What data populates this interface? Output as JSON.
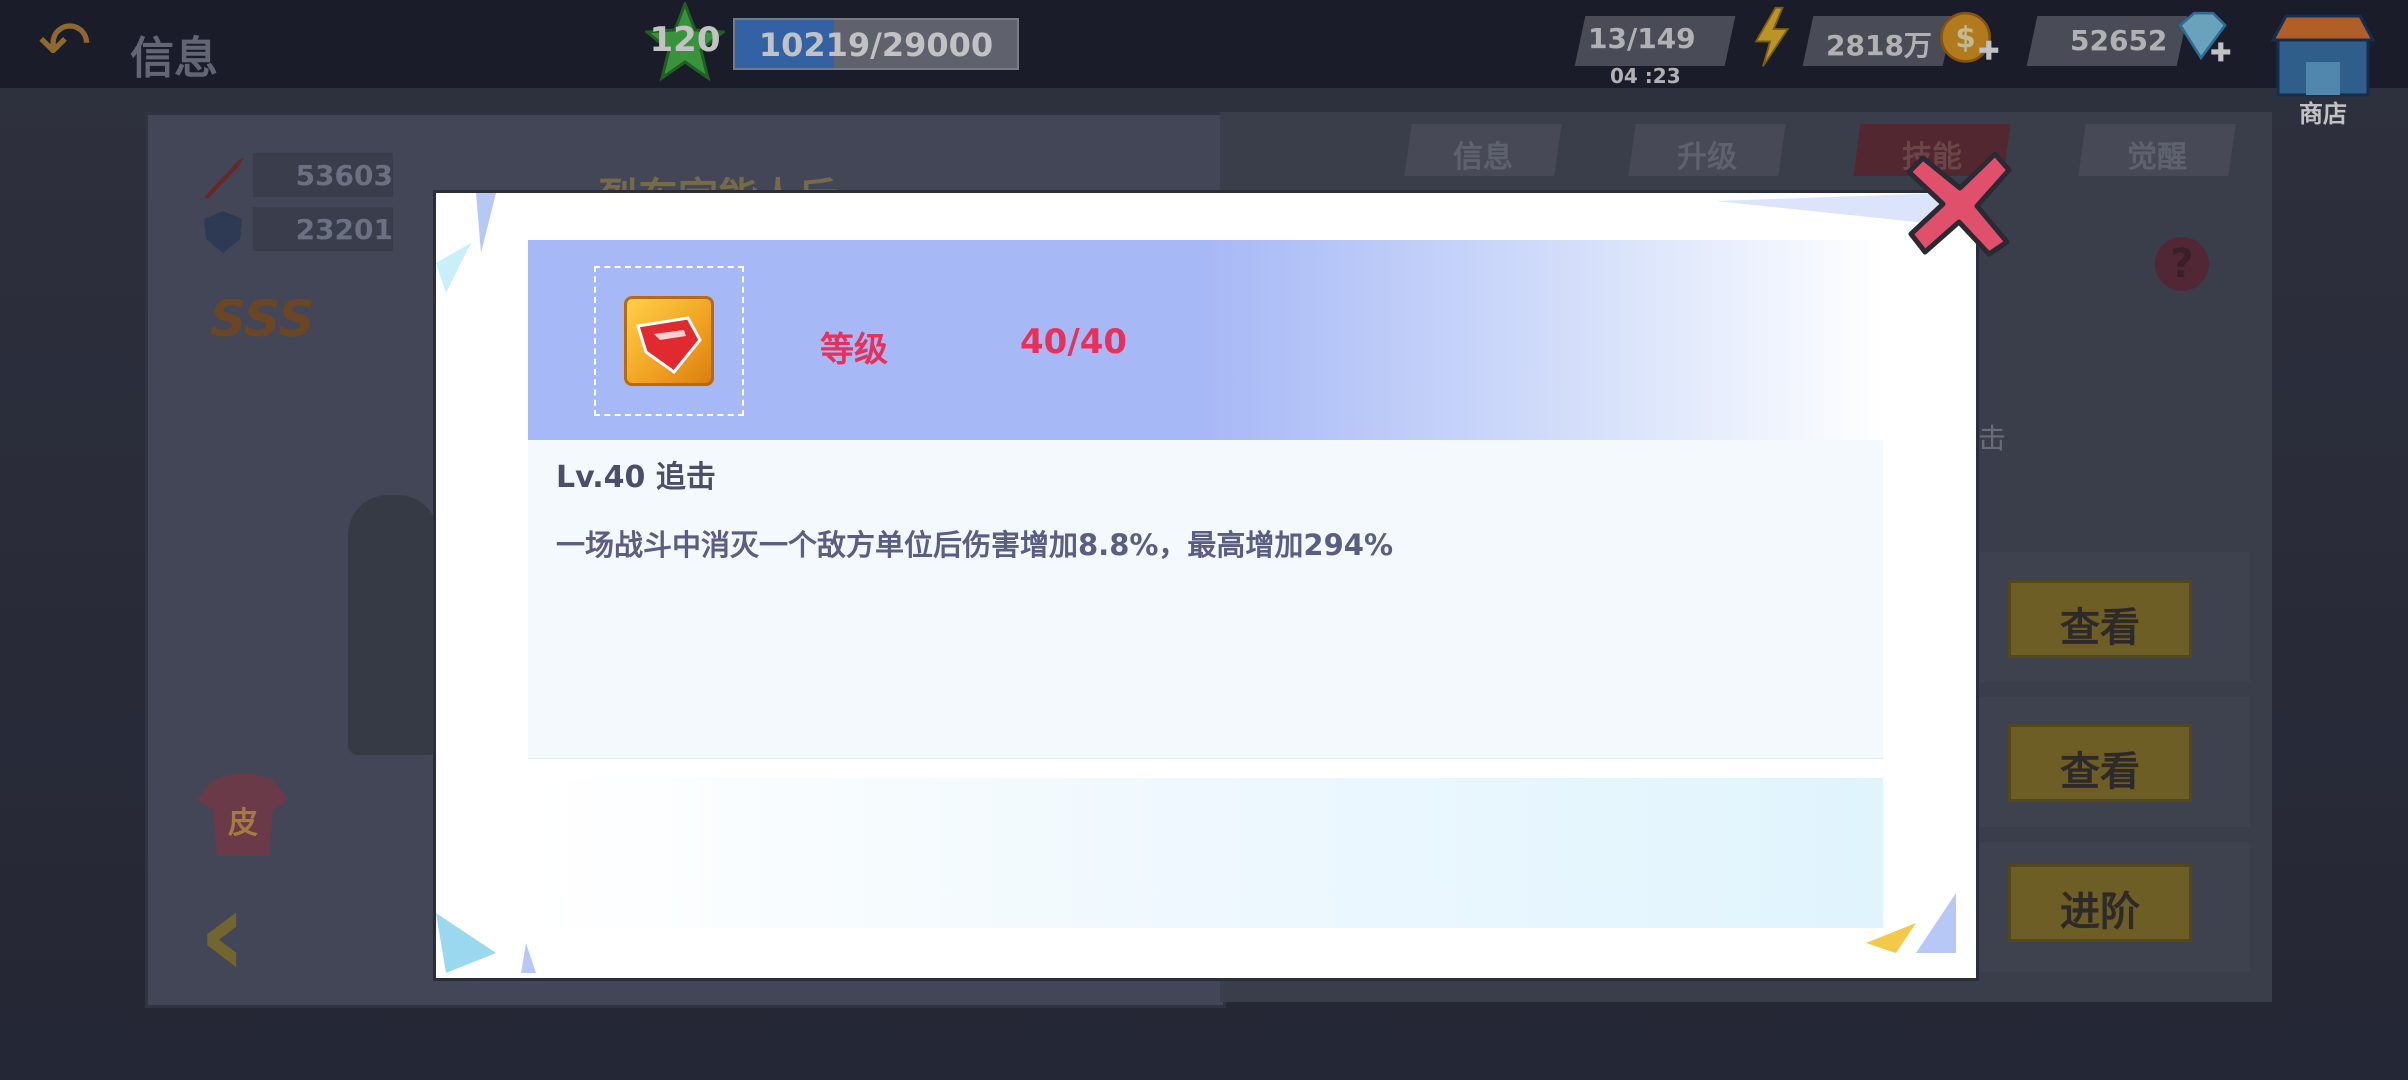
{
  "topbar": {
    "back_label": "信息",
    "level": "120",
    "exp_text": "10219/29000",
    "exp_fraction": 0.352,
    "energy": "13/149",
    "energy_timer": "04 :23",
    "gold": "2818万",
    "gems": "52652",
    "shop_label": "商店"
  },
  "left_panel": {
    "attack": "53603",
    "defense": "23201",
    "rank": "SSS",
    "hero_name": "烈东宗能人斥",
    "shirt_label": "皮"
  },
  "right_panel": {
    "tabs": [
      "信息",
      "升级",
      "技能",
      "觉醒"
    ],
    "partial_text": "击",
    "buttons": [
      "查看",
      "查看",
      "进阶"
    ]
  },
  "modal": {
    "level_label": "等级",
    "level_value": "40/40",
    "skill_title": "Lv.40 追击",
    "skill_desc": "一场战斗中消灭一个敌方单位后伤害增加8.8%，最高增加294%"
  },
  "colors": {
    "accent_pink": "#e8305a",
    "header_blue": "#a7b8f6",
    "text_navy": "#4a4e6a"
  },
  "icons": {
    "back": "back-arrow-icon",
    "level": "green-star-icon",
    "energy": "lightning-icon",
    "gold": "coin-plus-icon",
    "gems": "diamond-plus-icon",
    "shop": "shop-icon",
    "close": "close-x-icon",
    "skill": "chase-skill-icon",
    "help": "question-icon"
  }
}
